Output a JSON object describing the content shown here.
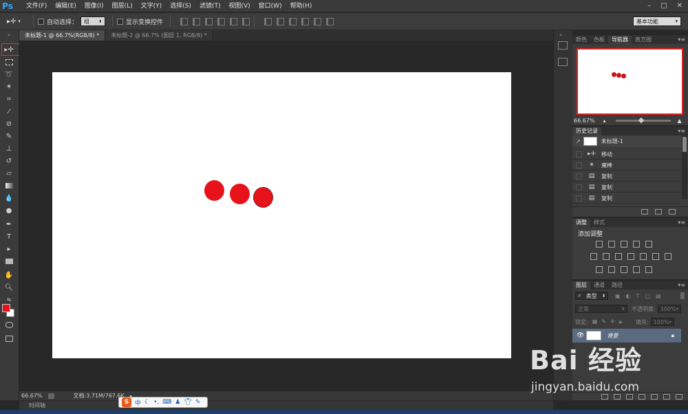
{
  "app": {
    "logo": "Ps"
  },
  "menu": [
    "文件(F)",
    "编辑(E)",
    "图像(I)",
    "图层(L)",
    "文字(Y)",
    "选择(S)",
    "滤镜(T)",
    "视图(V)",
    "窗口(W)",
    "帮助(H)"
  ],
  "window_controls": [
    "–",
    "□",
    "✕"
  ],
  "options": {
    "auto_select_label": "自动选择：",
    "auto_select_value": "组",
    "show_transform_label": "显示变换控件",
    "workspace": "基本功能"
  },
  "tabs": [
    {
      "label": "未标题-1 @ 66.7%(RGB/8) *",
      "active": true
    },
    {
      "label": "未标题-2 @ 66.7% (图层 1, RGB/8) *",
      "active": false
    }
  ],
  "colors": {
    "foreground": "#e8101a",
    "background": "#ffffff",
    "accent": "#e53030"
  },
  "status": {
    "zoom": "66.67%",
    "doc_info": "文档:3.71M/767.6K",
    "timeline": "时间轴"
  },
  "ime": {
    "label": "中"
  },
  "navigator": {
    "tabs": [
      "颜色",
      "色板",
      "导航器",
      "直方图"
    ],
    "active_tab": "导航器",
    "zoom": "66.67%"
  },
  "history": {
    "title": "历史记录",
    "snapshot": "未标题-1",
    "items": [
      "移动",
      "魔棒",
      "复制",
      "复制",
      "复制"
    ]
  },
  "adjustments": {
    "tabs": [
      "调整",
      "样式"
    ],
    "title": "添加调整"
  },
  "layers": {
    "tabs": [
      "图层",
      "通道",
      "路径"
    ],
    "filter_label": "类型",
    "blend_mode": "正常",
    "opacity_label": "不透明度:",
    "opacity_value": "100%",
    "lock_label": "锁定:",
    "fill_label": "填充:",
    "fill_value": "100%",
    "layer_name": "背景"
  },
  "watermark": {
    "brand": "Bai  经验",
    "url": "jingyan.baidu.com"
  }
}
